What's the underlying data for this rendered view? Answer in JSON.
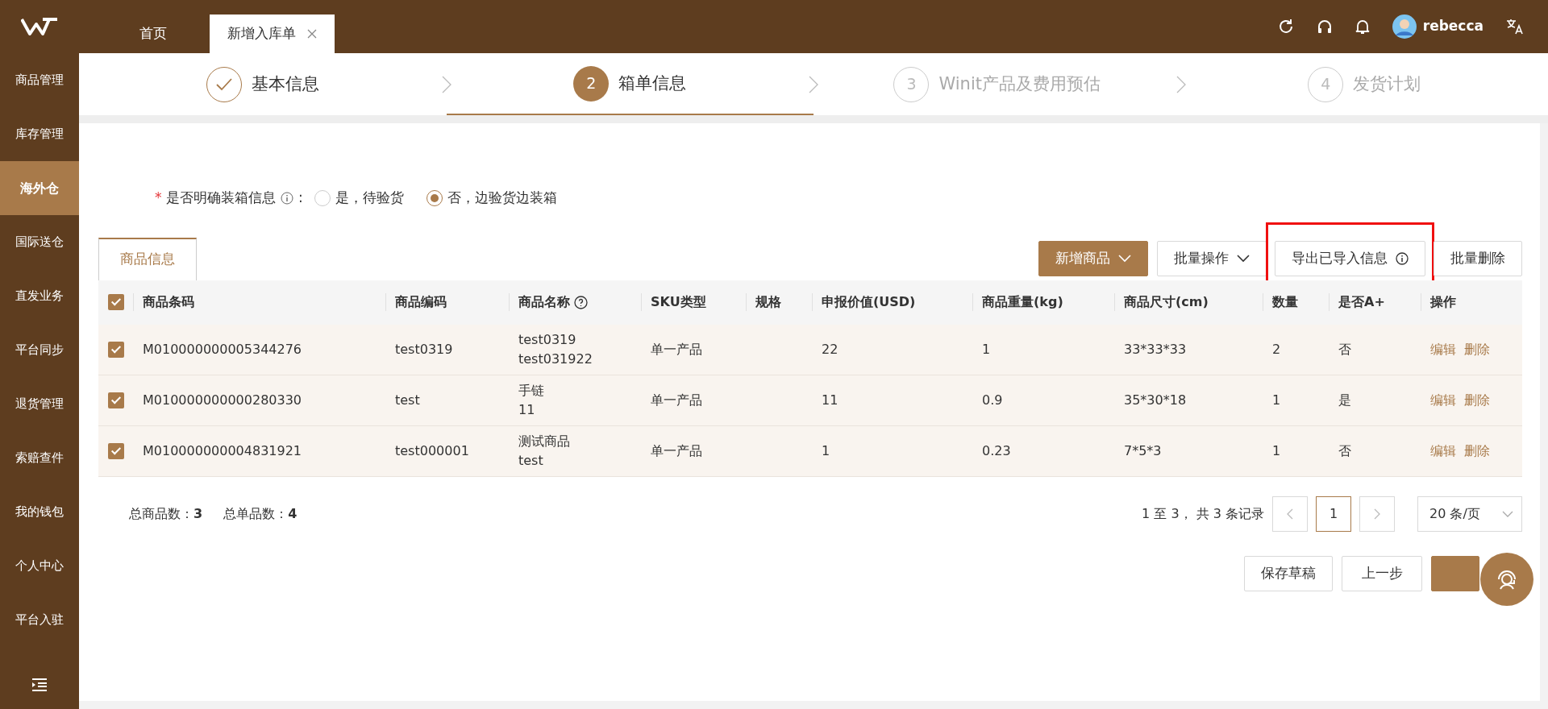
{
  "top_bar": {
    "tabs": [
      {
        "label": "首页",
        "selected": false,
        "closable": false
      },
      {
        "label": "新增入库单",
        "selected": true,
        "closable": true
      }
    ],
    "user": "rebecca"
  },
  "sidebar": {
    "items": [
      {
        "label": "商品管理",
        "selected": false
      },
      {
        "label": "库存管理",
        "selected": false
      },
      {
        "label": "海外仓",
        "selected": true
      },
      {
        "label": "国际送仓",
        "selected": false
      },
      {
        "label": "直发业务",
        "selected": false
      },
      {
        "label": "平台同步",
        "selected": false
      },
      {
        "label": "退货管理",
        "selected": false
      },
      {
        "label": "索赔查件",
        "selected": false
      },
      {
        "label": "我的钱包",
        "selected": false
      },
      {
        "label": "个人中心",
        "selected": false
      },
      {
        "label": "平台入驻",
        "selected": false
      }
    ]
  },
  "steps": [
    {
      "label": "基本信息",
      "completed": true,
      "selected": false
    },
    {
      "number": "2",
      "label": "箱单信息",
      "completed": false,
      "selected": true
    },
    {
      "number": "3",
      "label": "Winit产品及费用预估",
      "completed": false,
      "selected": false
    },
    {
      "number": "4",
      "label": "发货计划",
      "completed": false,
      "selected": false
    }
  ],
  "form": {
    "required_mark": "*",
    "label": "是否明确装箱信息",
    "colon": ":",
    "options": [
      {
        "label": "是，待验货",
        "selected": false
      },
      {
        "label": "否，边验货边装箱",
        "selected": true
      }
    ]
  },
  "panel_tab": "商品信息",
  "actions": [
    {
      "label": "新增商品",
      "kind": "primary",
      "dropdown": true,
      "info": false,
      "highlighted": false
    },
    {
      "label": "批量操作",
      "kind": "default",
      "dropdown": true,
      "info": false,
      "highlighted": false
    },
    {
      "label": "导出已导入信息",
      "kind": "default",
      "dropdown": false,
      "info": true,
      "highlighted": true
    },
    {
      "label": "批量删除",
      "kind": "default",
      "dropdown": false,
      "info": false,
      "highlighted": false
    }
  ],
  "table": {
    "all_checked": true,
    "columns": [
      {
        "label": "商品条码",
        "kind": "plain"
      },
      {
        "label": "商品编码",
        "kind": "plain"
      },
      {
        "label": "商品名称",
        "kind": "help"
      },
      {
        "label": "SKU类型",
        "kind": "plain"
      },
      {
        "label": "规格",
        "kind": "plain"
      },
      {
        "label": "申报价值(USD)",
        "kind": "plain"
      },
      {
        "label": "商品重量(kg)",
        "kind": "plain"
      },
      {
        "label": "商品尺寸(cm)",
        "kind": "plain"
      },
      {
        "label": "数量",
        "kind": "plain"
      },
      {
        "label": "是否A+",
        "kind": "plain"
      },
      {
        "label": "操作",
        "kind": "plain"
      }
    ],
    "rows": [
      {
        "checked": true,
        "barcode": "M010000000005344276",
        "code": "test0319",
        "name": [
          "test0319",
          "test031922"
        ],
        "sku_type": "单一产品",
        "value": "22",
        "weight": "1",
        "size": "33*33*33",
        "qty": "2",
        "a_plus": "否",
        "ops": [
          "编辑",
          "删除"
        ]
      },
      {
        "checked": true,
        "barcode": "M010000000000280330",
        "code": "test",
        "name": [
          "手链",
          "11"
        ],
        "sku_type": "单一产品",
        "value": "11",
        "weight": "0.9",
        "size": "35*30*18",
        "qty": "1",
        "a_plus": "是",
        "ops": [
          "编辑",
          "删除"
        ]
      },
      {
        "checked": true,
        "barcode": "M010000000004831921",
        "code": "test000001",
        "name": [
          "测试商品",
          "test"
        ],
        "sku_type": "单一产品",
        "value": "1",
        "weight": "0.23",
        "size": "7*5*3",
        "qty": "1",
        "a_plus": "否",
        "ops": [
          "编辑",
          "删除"
        ]
      }
    ]
  },
  "summary": [
    {
      "label": "总商品数：",
      "value": "3"
    },
    {
      "label": "总单品数：",
      "value": "4"
    }
  ],
  "pagination": {
    "info": "1 至 3， 共 3 条记录",
    "pages": [
      {
        "label": "1",
        "selected": true
      }
    ],
    "page_size": "20 条/页"
  },
  "footer_buttons": [
    {
      "label": "保存草稿",
      "kind": "default"
    },
    {
      "label": "上一步",
      "kind": "default"
    },
    {
      "kind": "primary"
    }
  ]
}
